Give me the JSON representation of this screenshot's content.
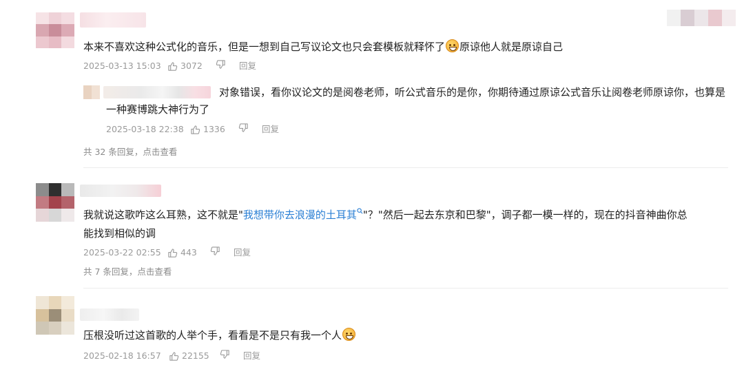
{
  "comments": [
    {
      "text_before": "本来不喜欢这种公式化的音乐，但是一想到自己写议论文也只会套模板就释怀了",
      "emoji": "grinning-face-emoji",
      "text_after": "原谅他人就是原谅自己",
      "date": "2025-03-13 15:03",
      "likes": "3072",
      "reply_label": "回复",
      "reply": {
        "text_line1": "对象错误，看你议论文的是阅卷老师，听公式音乐的是你，你期待通过原谅公式音乐让阅卷老师原谅你，也算是",
        "text_line2": "一种赛博跳大神行为了",
        "date": "2025-03-18 22:38",
        "likes": "1336",
        "reply_label": "回复"
      },
      "more_replies": "共 32 条回复，点击查看"
    },
    {
      "text_before": "我就说这歌咋这么耳熟，这不就是\"",
      "link": "我想带你去浪漫的土耳其",
      "text_after_line1": "\"？\"然后一起去东京和巴黎\"，调子都一模一样的，现在的抖音神曲你总",
      "text_line2": "能找到相似的调",
      "date": "2025-03-22 02:55",
      "likes": "443",
      "reply_label": "回复",
      "more_replies": "共 7 条回复，点击查看"
    },
    {
      "text_before": "压根没听过这首歌的人举个手，看看是不是只有我一个人",
      "emoji": "laughing-face-emoji",
      "date": "2025-02-18 16:57",
      "likes": "22155",
      "reply_label": "回复"
    }
  ],
  "colors": {
    "text": "#1f1f1f",
    "meta": "#9a9a9a",
    "link": "#2a7fd4",
    "divider": "#ececec"
  }
}
